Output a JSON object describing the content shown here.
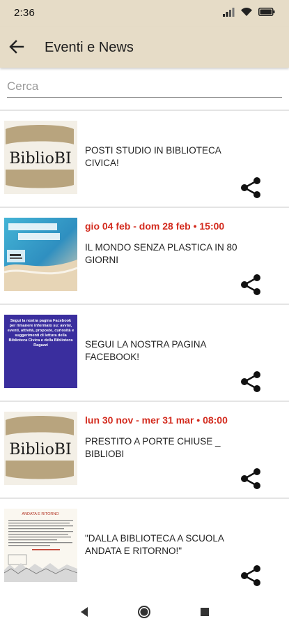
{
  "status_bar": {
    "time": "2:36",
    "icons": [
      "signal-icon",
      "wifi-icon",
      "battery-icon"
    ]
  },
  "app_bar": {
    "title": "Eventi e News",
    "back_icon": "back-arrow-icon"
  },
  "search": {
    "placeholder": "Cerca",
    "value": ""
  },
  "items": [
    {
      "date": "",
      "title": "POSTI STUDIO IN BIBLIOTECA CIVICA!",
      "thumb": "bibliobi-logo",
      "logo_text": "BiblioBI"
    },
    {
      "date": "gio 04 feb  - dom 28 feb • 15:00",
      "title": "IL MONDO SENZA PLASTICA IN 80 GIORNI",
      "thumb": "plastica-poster"
    },
    {
      "date": "",
      "title": "SEGUI LA NOSTRA PAGINA FACEBOOK!",
      "thumb": "facebook-poster",
      "poster_text": "Segui la nostra pagina Facebook per rimanere informato su: avvisi, eventi, attività, proposte, curiosità e suggerimenti di lettura della Biblioteca Civica e della Biblioteca Ragazzi"
    },
    {
      "date": "lun 30 nov  - mer 31 mar • 08:00",
      "title": "PRESTITO A PORTE CHIUSE _ BIBLIOBI",
      "thumb": "bibliobi-logo",
      "logo_text": "BiblioBI"
    },
    {
      "date": "",
      "title": "\"DALLA BIBLIOTECA A SCUOLA ANDATA E RITORNO!\"",
      "thumb": "andata-ritorno-poster",
      "poster_title": "ANDATA E RITORNO"
    }
  ],
  "colors": {
    "app_bar_bg": "#e6dcc7",
    "date_red": "#d32b1e",
    "logo_tan": "#b8a47e",
    "facebook_poster_bg": "#3a2e9e"
  },
  "nav": {
    "icons": [
      "back-triangle-icon",
      "home-circle-icon",
      "recents-square-icon"
    ]
  }
}
